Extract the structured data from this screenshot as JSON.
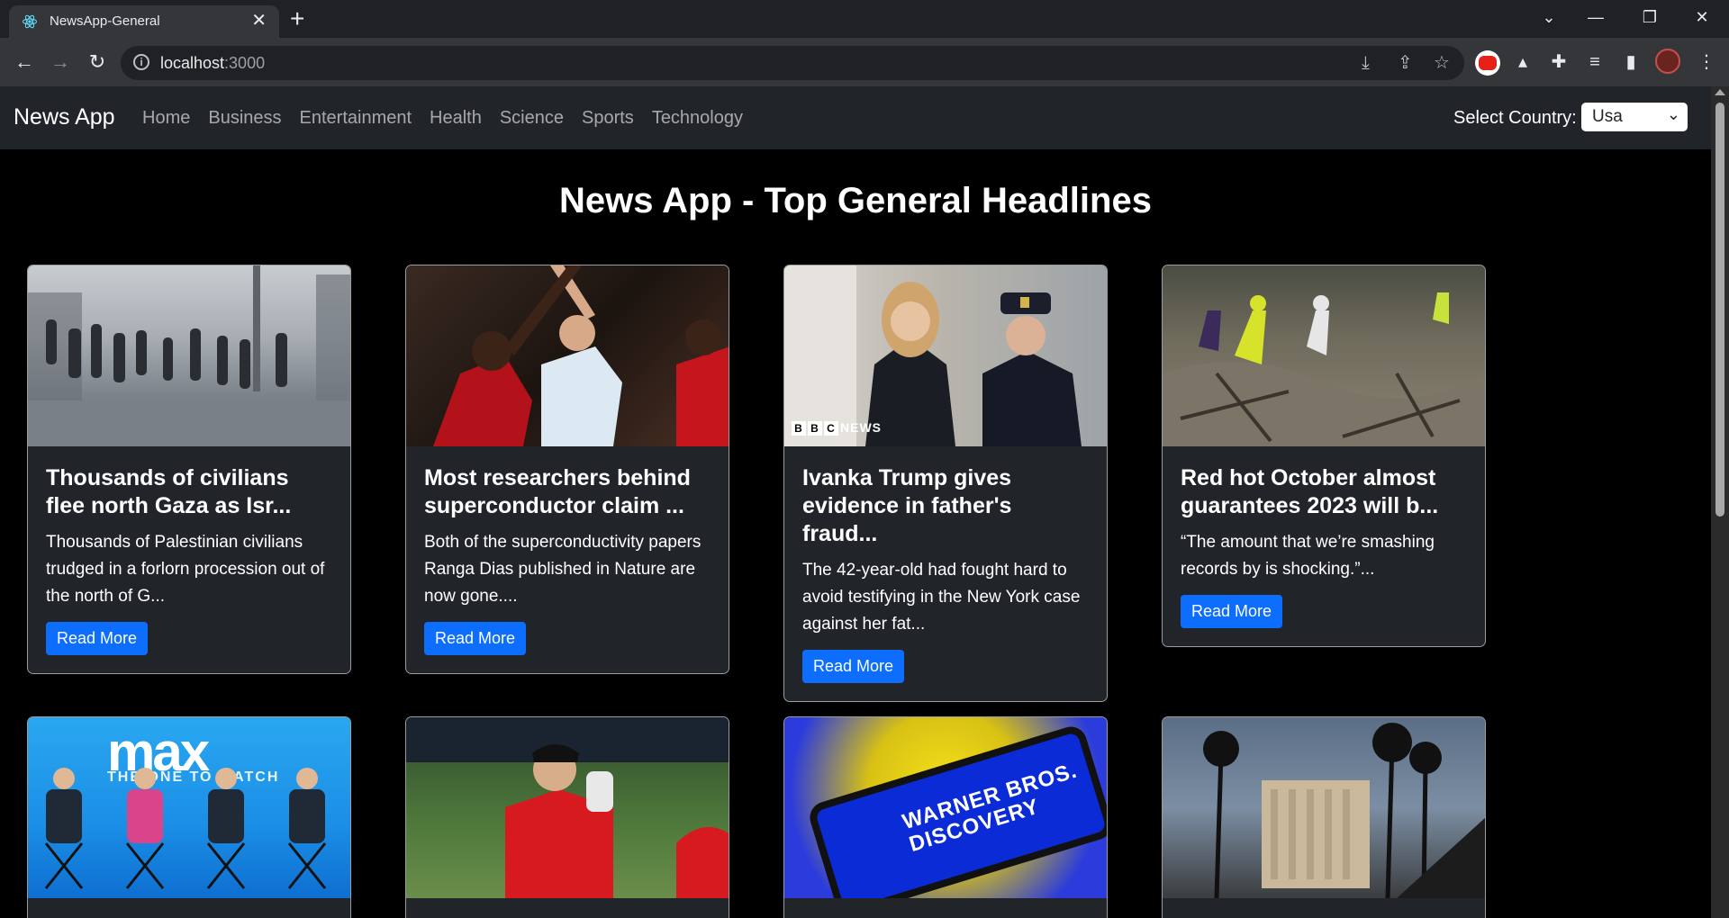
{
  "browser": {
    "tab_title": "NewsApp-General",
    "close_glyph": "✕",
    "new_tab_glyph": "+",
    "url_host": "localhost",
    "url_port": ":3000",
    "icons": [
      "back-icon",
      "forward-icon",
      "reload-icon",
      "info-icon",
      "install-icon",
      "share-icon",
      "star-icon",
      "youtube-extension-icon",
      "extension-icon",
      "puzzle-icon",
      "media-icon",
      "sidepanel-icon",
      "profile-avatar",
      "menu-icon"
    ]
  },
  "navbar": {
    "brand": "News App",
    "links": [
      "Home",
      "Business",
      "Entertainment",
      "Health",
      "Science",
      "Sports",
      "Technology"
    ],
    "country_label": "Select Country:",
    "country_value": "Usa"
  },
  "main": {
    "heading": "News App - Top General Headlines",
    "read_more": "Read More",
    "cards": [
      {
        "title": "Thousands of civilians flee north Gaza as Isr...",
        "description": "Thousands of Palestinian civilians trudged in a forlorn procession out of the north of G...",
        "image_desc": "gaza-street-photo"
      },
      {
        "title": "Most researchers behind superconductor claim ...",
        "description": "Both of the superconductivity papers Ranga Dias published in Nature are now gone....",
        "image_desc": "basketball-photo"
      },
      {
        "title": "Ivanka Trump gives evidence in father's fraud...",
        "description": "The 42-year-old had fought hard to avoid testifying in the New York case against her fat...",
        "image_desc": "ivanka-court-photo",
        "image_overlay": "NEWS",
        "image_overlay_letters": [
          "B",
          "B",
          "C"
        ]
      },
      {
        "title": "Red hot October almost guarantees 2023 will b...",
        "description": "“The amount that we’re smashing records by is shocking.”...",
        "image_desc": "flood-rescue-photo"
      }
    ],
    "second_row": [
      {
        "image_desc": "max-panel-photo",
        "logo": "max",
        "tagline": "THE ONE TO WATCH"
      },
      {
        "image_desc": "baseball-photo"
      },
      {
        "image_desc": "warner-bros-phone-photo",
        "logo_text": "WARNER BROS. DISCOVERY"
      },
      {
        "image_desc": "las-vegas-photo"
      }
    ]
  },
  "colors": {
    "navbar_bg": "#212529",
    "page_bg": "#000000",
    "button_primary": "#0d6efd",
    "card_bg": "#212529"
  }
}
